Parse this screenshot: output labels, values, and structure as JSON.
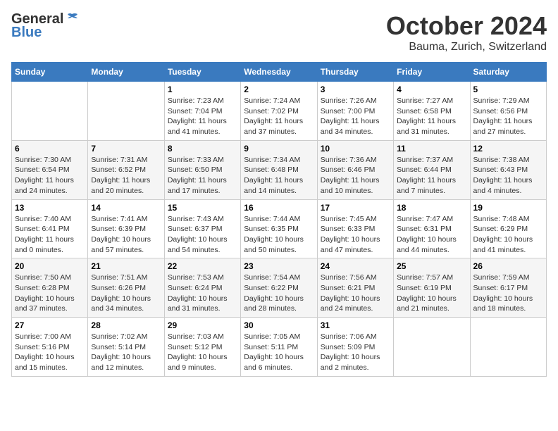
{
  "header": {
    "logo_general": "General",
    "logo_blue": "Blue",
    "month_title": "October 2024",
    "location": "Bauma, Zurich, Switzerland"
  },
  "columns": [
    "Sunday",
    "Monday",
    "Tuesday",
    "Wednesday",
    "Thursday",
    "Friday",
    "Saturday"
  ],
  "weeks": [
    [
      {
        "day": "",
        "content": ""
      },
      {
        "day": "",
        "content": ""
      },
      {
        "day": "1",
        "content": "Sunrise: 7:23 AM\nSunset: 7:04 PM\nDaylight: 11 hours and 41 minutes."
      },
      {
        "day": "2",
        "content": "Sunrise: 7:24 AM\nSunset: 7:02 PM\nDaylight: 11 hours and 37 minutes."
      },
      {
        "day": "3",
        "content": "Sunrise: 7:26 AM\nSunset: 7:00 PM\nDaylight: 11 hours and 34 minutes."
      },
      {
        "day": "4",
        "content": "Sunrise: 7:27 AM\nSunset: 6:58 PM\nDaylight: 11 hours and 31 minutes."
      },
      {
        "day": "5",
        "content": "Sunrise: 7:29 AM\nSunset: 6:56 PM\nDaylight: 11 hours and 27 minutes."
      }
    ],
    [
      {
        "day": "6",
        "content": "Sunrise: 7:30 AM\nSunset: 6:54 PM\nDaylight: 11 hours and 24 minutes."
      },
      {
        "day": "7",
        "content": "Sunrise: 7:31 AM\nSunset: 6:52 PM\nDaylight: 11 hours and 20 minutes."
      },
      {
        "day": "8",
        "content": "Sunrise: 7:33 AM\nSunset: 6:50 PM\nDaylight: 11 hours and 17 minutes."
      },
      {
        "day": "9",
        "content": "Sunrise: 7:34 AM\nSunset: 6:48 PM\nDaylight: 11 hours and 14 minutes."
      },
      {
        "day": "10",
        "content": "Sunrise: 7:36 AM\nSunset: 6:46 PM\nDaylight: 11 hours and 10 minutes."
      },
      {
        "day": "11",
        "content": "Sunrise: 7:37 AM\nSunset: 6:44 PM\nDaylight: 11 hours and 7 minutes."
      },
      {
        "day": "12",
        "content": "Sunrise: 7:38 AM\nSunset: 6:43 PM\nDaylight: 11 hours and 4 minutes."
      }
    ],
    [
      {
        "day": "13",
        "content": "Sunrise: 7:40 AM\nSunset: 6:41 PM\nDaylight: 11 hours and 0 minutes."
      },
      {
        "day": "14",
        "content": "Sunrise: 7:41 AM\nSunset: 6:39 PM\nDaylight: 10 hours and 57 minutes."
      },
      {
        "day": "15",
        "content": "Sunrise: 7:43 AM\nSunset: 6:37 PM\nDaylight: 10 hours and 54 minutes."
      },
      {
        "day": "16",
        "content": "Sunrise: 7:44 AM\nSunset: 6:35 PM\nDaylight: 10 hours and 50 minutes."
      },
      {
        "day": "17",
        "content": "Sunrise: 7:45 AM\nSunset: 6:33 PM\nDaylight: 10 hours and 47 minutes."
      },
      {
        "day": "18",
        "content": "Sunrise: 7:47 AM\nSunset: 6:31 PM\nDaylight: 10 hours and 44 minutes."
      },
      {
        "day": "19",
        "content": "Sunrise: 7:48 AM\nSunset: 6:29 PM\nDaylight: 10 hours and 41 minutes."
      }
    ],
    [
      {
        "day": "20",
        "content": "Sunrise: 7:50 AM\nSunset: 6:28 PM\nDaylight: 10 hours and 37 minutes."
      },
      {
        "day": "21",
        "content": "Sunrise: 7:51 AM\nSunset: 6:26 PM\nDaylight: 10 hours and 34 minutes."
      },
      {
        "day": "22",
        "content": "Sunrise: 7:53 AM\nSunset: 6:24 PM\nDaylight: 10 hours and 31 minutes."
      },
      {
        "day": "23",
        "content": "Sunrise: 7:54 AM\nSunset: 6:22 PM\nDaylight: 10 hours and 28 minutes."
      },
      {
        "day": "24",
        "content": "Sunrise: 7:56 AM\nSunset: 6:21 PM\nDaylight: 10 hours and 24 minutes."
      },
      {
        "day": "25",
        "content": "Sunrise: 7:57 AM\nSunset: 6:19 PM\nDaylight: 10 hours and 21 minutes."
      },
      {
        "day": "26",
        "content": "Sunrise: 7:59 AM\nSunset: 6:17 PM\nDaylight: 10 hours and 18 minutes."
      }
    ],
    [
      {
        "day": "27",
        "content": "Sunrise: 7:00 AM\nSunset: 5:16 PM\nDaylight: 10 hours and 15 minutes."
      },
      {
        "day": "28",
        "content": "Sunrise: 7:02 AM\nSunset: 5:14 PM\nDaylight: 10 hours and 12 minutes."
      },
      {
        "day": "29",
        "content": "Sunrise: 7:03 AM\nSunset: 5:12 PM\nDaylight: 10 hours and 9 minutes."
      },
      {
        "day": "30",
        "content": "Sunrise: 7:05 AM\nSunset: 5:11 PM\nDaylight: 10 hours and 6 minutes."
      },
      {
        "day": "31",
        "content": "Sunrise: 7:06 AM\nSunset: 5:09 PM\nDaylight: 10 hours and 2 minutes."
      },
      {
        "day": "",
        "content": ""
      },
      {
        "day": "",
        "content": ""
      }
    ]
  ]
}
